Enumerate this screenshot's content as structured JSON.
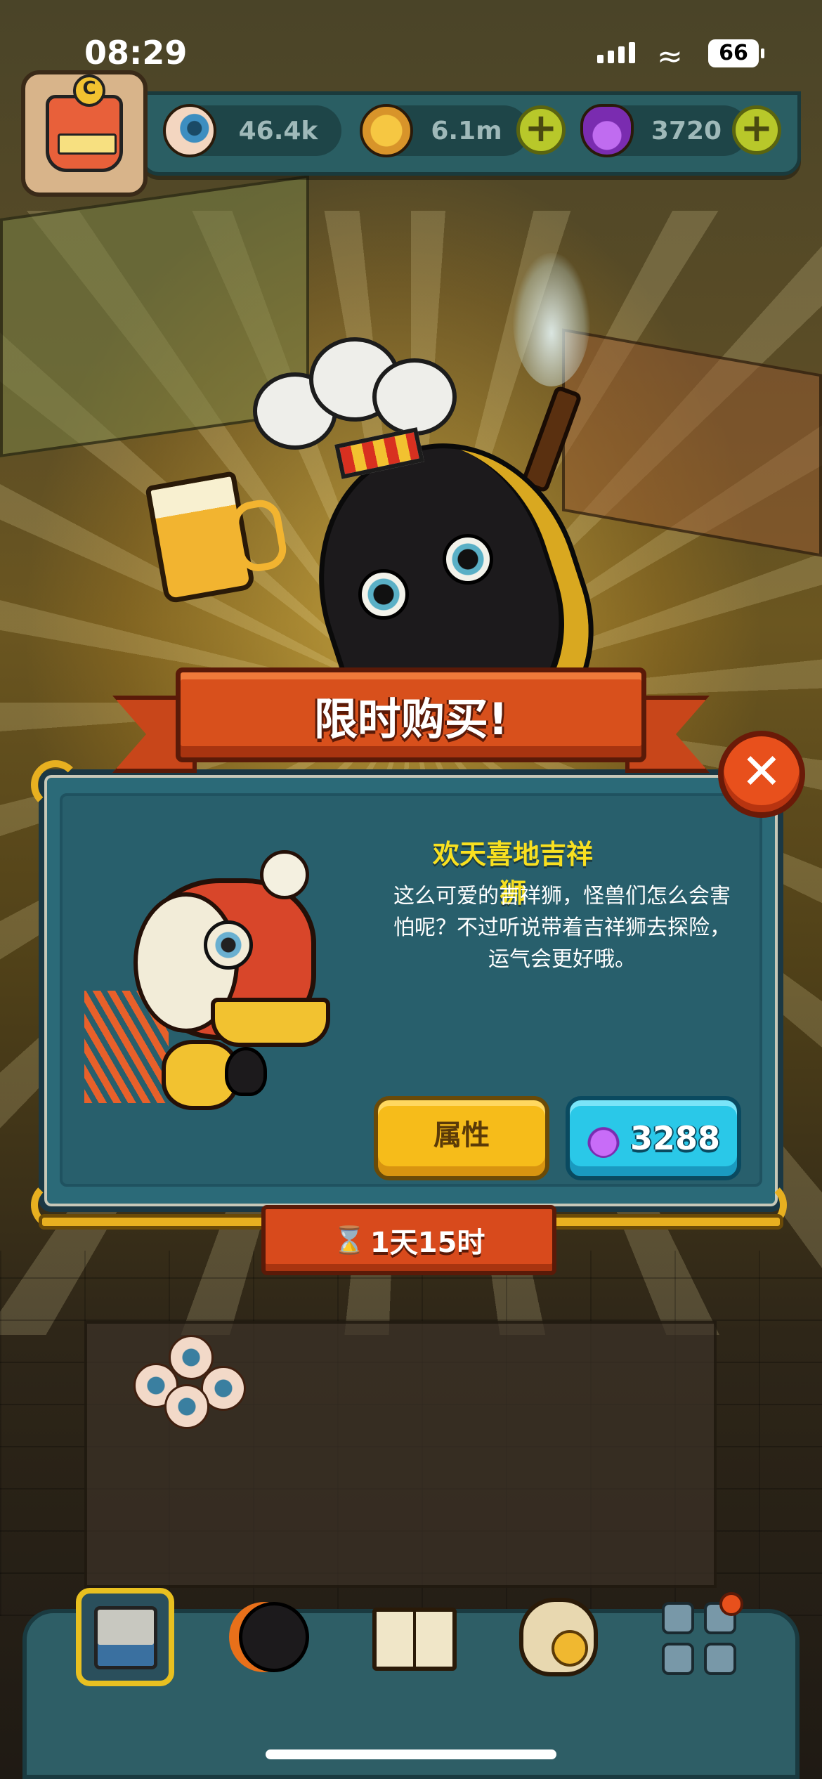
{
  "status_bar": {
    "time": "08:29",
    "battery": "66"
  },
  "resources": {
    "eyeballs": "46.4k",
    "coins": "6.1m",
    "potions": "3720"
  },
  "banner": {
    "title": "限时购买!"
  },
  "item": {
    "name": "欢天喜地吉祥狮",
    "description_lines": [
      "这么可爱的吉祥狮，怪兽们怎么会害",
      "怕呢？不过听说带着吉祥狮去探险，",
      "运气会更好哦。"
    ]
  },
  "buttons": {
    "attributes": "属性",
    "price": "3288"
  },
  "timer": {
    "remaining": "1天15时"
  },
  "icons": {
    "close": "close-icon",
    "eyeball": "eyeball-icon",
    "coin": "coin-icon",
    "potion": "potion-icon",
    "hourglass": "hourglass-icon"
  },
  "colors": {
    "title_yellow": "#f8e020",
    "banner_red": "#d8501c",
    "panel_teal": "#2b6a78",
    "buy_cyan": "#2ac8e8",
    "attr_gold": "#f6bc1a"
  }
}
